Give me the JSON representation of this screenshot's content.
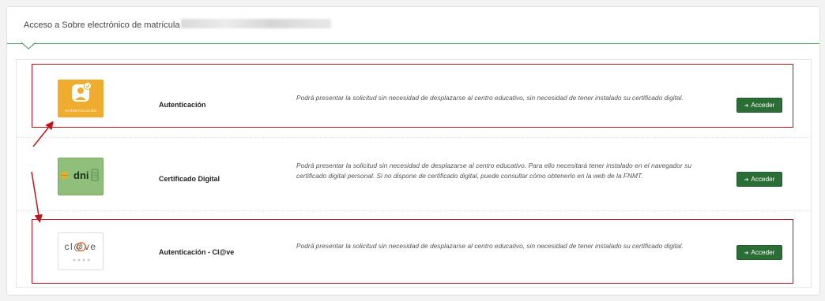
{
  "panel": {
    "title": "Acceso a Sobre electrónico de matrícula"
  },
  "options": [
    {
      "name": "Autenticación",
      "logo_label": "AUTENTICACIÓN",
      "description": "Podrá presentar la solicitud sin necesidad de desplazarse al centro educativo, sin necesidad de tener instalado su certificado digital.",
      "button": "Acceder"
    },
    {
      "name": "Certificado Digital",
      "logo_label": "dni",
      "description": "Podrá presentar la solicitud sin necesidad de desplazarse al centro educativo. Para ello necesitará tener instalado en el navegador su certificado digital personal. Si no dispone de certificado digital, puede consultar cómo obtenerlo en la web de la FNMT.",
      "button": "Acceder"
    },
    {
      "name": "Autenticación - Cl@ve",
      "logo_label": "cl@ve",
      "description": "Podrá presentar la solicitud sin necesidad de desplazarse al centro educativo, sin necesidad de tener instalado su certificado digital.",
      "button": "Acceder"
    }
  ],
  "colors": {
    "accent_green": "#2a6e36",
    "header_line": "#3a8f5c",
    "highlight_red": "#c0141c",
    "auth_logo_orange": "#f0ac2e",
    "dni_logo_green": "#8fbf7a"
  },
  "icons": {
    "button_icon": "sign-in-icon",
    "auth_logo_icon": "user-check-icon"
  }
}
